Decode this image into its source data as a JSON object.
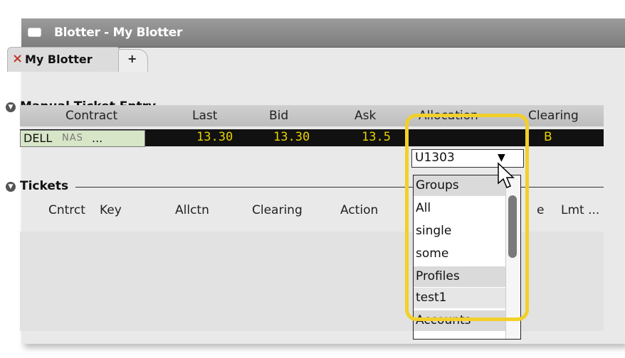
{
  "window": {
    "title": "Blotter - My Blotter",
    "icon": "window-icon"
  },
  "tabs": [
    {
      "label": "My Blotter",
      "close": "×"
    },
    {
      "label": "+"
    }
  ],
  "manual_ticket_entry": {
    "heading": "Manual Ticket Entry",
    "columns": [
      "Contract",
      "Last",
      "Bid",
      "Ask",
      "Allocation",
      "Clearing"
    ],
    "row": {
      "symbol": "DELL",
      "exchange": "NAS",
      "ellipsis": "...",
      "last": "13.30",
      "bid": "13.30",
      "ask": "13.5",
      "allocation": "U1303",
      "clearing": "B"
    }
  },
  "tickets": {
    "heading": "Tickets",
    "columns": [
      "Cntrct",
      "Key",
      "Allctn",
      "Clearing",
      "Action",
      "e",
      "Lmt ..."
    ]
  },
  "allocation_dropdown": {
    "selected": "U1303",
    "items": [
      {
        "label": "Groups",
        "kind": "group-header"
      },
      {
        "label": "All",
        "kind": "item"
      },
      {
        "label": "single",
        "kind": "item"
      },
      {
        "label": "some",
        "kind": "item"
      },
      {
        "label": "Profiles",
        "kind": "group-header"
      },
      {
        "label": "test1",
        "kind": "selected"
      },
      {
        "label": "Accounts",
        "kind": "group-header"
      }
    ]
  },
  "colors": {
    "highlight": "#f2d02a",
    "ticker": "#e8d200",
    "row_bg": "#111111"
  }
}
